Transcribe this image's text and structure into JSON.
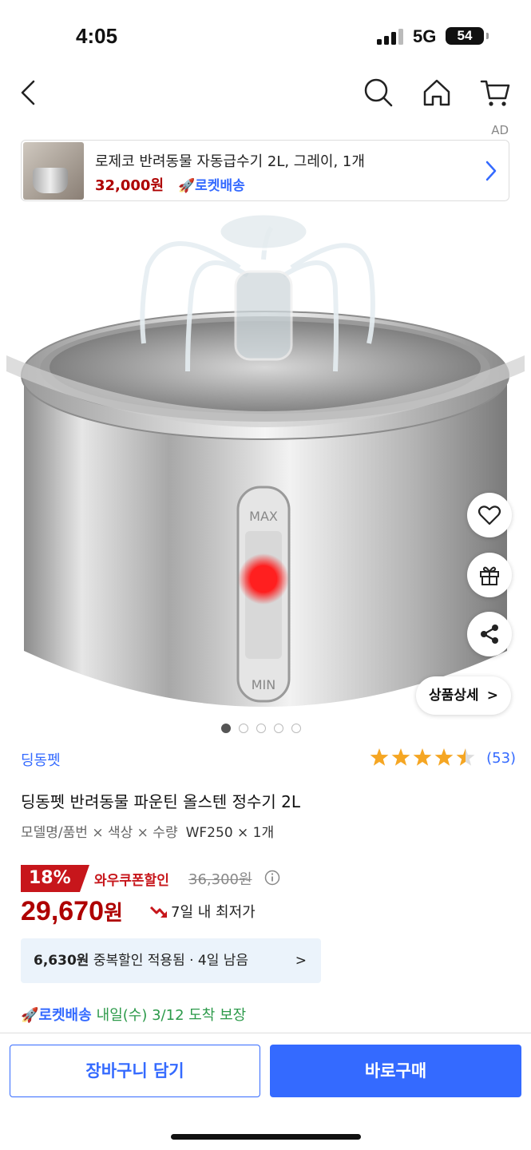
{
  "status_bar": {
    "time": "4:05",
    "network": "5G",
    "battery": "54"
  },
  "nav": {
    "icons": [
      "back-icon",
      "search-icon",
      "home-icon",
      "cart-icon"
    ]
  },
  "ad": {
    "tag": "AD",
    "title": "로제코 반려동물 자동급수기 2L, 그레이, 1개",
    "price": "32,000원",
    "delivery": "🚀로켓배송"
  },
  "hero": {
    "level_labels": {
      "max": "MAX",
      "min": "MIN"
    },
    "detail_label": "상품상세",
    "detail_chevron": ">",
    "page_count": 5,
    "active_page": 1
  },
  "product": {
    "brand": "딩동펫",
    "rating": 4.5,
    "review_count": "(53)",
    "title": "딩동펫 반려동물 파운틴 올스텐 정수기 2L",
    "option_label": "모델명/품번 × 색상 × 수량",
    "option_value": "WF250 × 1개"
  },
  "pricing": {
    "discount_badge": "18%",
    "coupon_label": "와우쿠폰할인",
    "original_price": "36,300원",
    "price_number": "29,670",
    "price_unit": "원",
    "lowest_label": "7일 내 최저가",
    "extra_discount_amount": "6,630원",
    "extra_discount_text": "중복할인 적용됨 · 4일 남음",
    "extra_chevron": ">"
  },
  "delivery": {
    "rocket_label": "🚀로켓배송",
    "date_text": "내일(수) 3/12 도착 보장"
  },
  "actions": {
    "cart_button": "장바구니 담기",
    "buy_button": "바로구매"
  },
  "colors": {
    "accent_blue": "#346aff",
    "price_red": "#ae0000",
    "badge_red": "#c7161b",
    "delivery_green": "#2c9a4a",
    "star_yellow": "#f5a623"
  }
}
